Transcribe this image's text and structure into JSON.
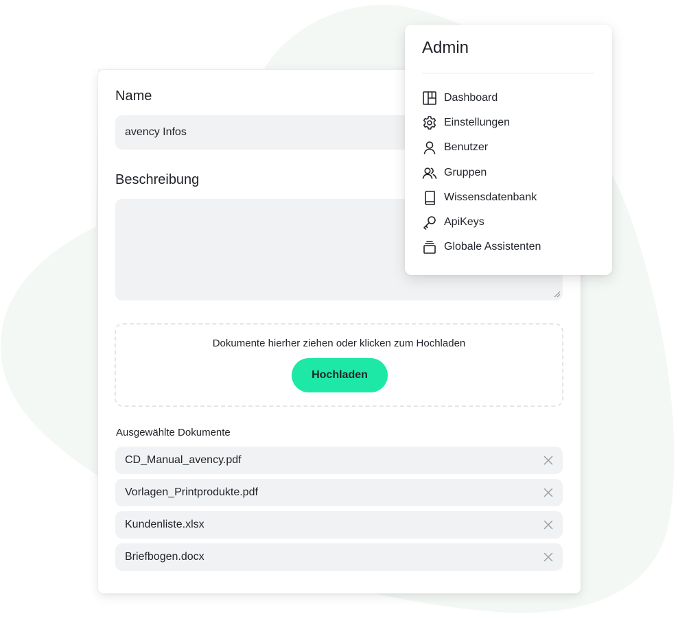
{
  "form": {
    "name_label": "Name",
    "name_value": "avency Infos",
    "description_label": "Beschreibung",
    "description_value": "",
    "dropzone_text": "Dokumente hierher ziehen oder klicken zum Hochladen",
    "upload_button": "Hochladen",
    "selected_title": "Ausgewählte Dokumente",
    "documents": [
      {
        "name": "CD_Manual_avency.pdf"
      },
      {
        "name": "Vorlagen_Printprodukte.pdf"
      },
      {
        "name": "Kundenliste.xlsx"
      },
      {
        "name": "Briefbogen.docx"
      }
    ],
    "remove_icon": "close-icon"
  },
  "admin_menu": {
    "title": "Admin",
    "items": [
      {
        "label": "Dashboard",
        "icon": "dashboard-icon"
      },
      {
        "label": "Einstellungen",
        "icon": "gear-icon"
      },
      {
        "label": "Benutzer",
        "icon": "user-icon"
      },
      {
        "label": "Gruppen",
        "icon": "users-icon"
      },
      {
        "label": "Wissensdatenbank",
        "icon": "book-icon"
      },
      {
        "label": "ApiKeys",
        "icon": "key-icon"
      },
      {
        "label": "Globale Assistenten",
        "icon": "stack-icon"
      }
    ]
  },
  "colors": {
    "accent": "#1ee8a6",
    "background_blob": "#f3f8f5",
    "input_bg": "#f1f2f4",
    "text": "#1f2328"
  }
}
